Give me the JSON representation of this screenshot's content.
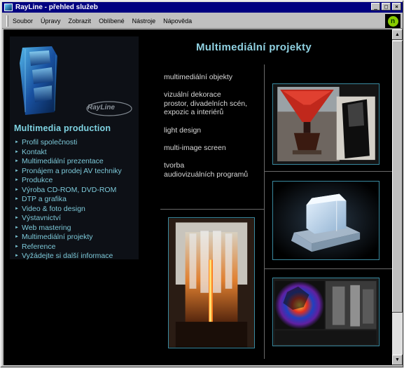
{
  "window": {
    "title": "RayLine - přehled služeb"
  },
  "menu": [
    {
      "label": "Soubor"
    },
    {
      "label": "Úpravy"
    },
    {
      "label": "Zobrazit"
    },
    {
      "label": "Oblíbené"
    },
    {
      "label": "Nástroje"
    },
    {
      "label": "Nápověda"
    }
  ],
  "sidebar": {
    "brand_badge": "RayLine",
    "heading": "Multimedia production",
    "items": [
      {
        "label": "Profil společnosti"
      },
      {
        "label": "Kontakt"
      },
      {
        "label": "Multimediální prezentace"
      },
      {
        "label": "Pronájem a prodej AV techniky"
      },
      {
        "label": "Produkce"
      },
      {
        "label": "Výroba CD-ROM, DVD-ROM"
      },
      {
        "label": "DTP a grafika"
      },
      {
        "label": "Video & foto design"
      },
      {
        "label": "Výstavnictví"
      },
      {
        "label": "Web mastering"
      },
      {
        "label": "Multimediální projekty"
      },
      {
        "label": "Reference"
      },
      {
        "label": "Vyžádejte si další informace"
      }
    ]
  },
  "main": {
    "title": "Multimediální projekty",
    "items": [
      {
        "label": "multimediální objekty"
      },
      {
        "line1": "vizuální dekorace",
        "line2": "prostor, divadelních scén,",
        "line3": "expozic a interiérů"
      },
      {
        "label": "light design"
      },
      {
        "label": "multi-image screen"
      },
      {
        "line1": "tvorba",
        "line2": "audiovizuálních programů"
      }
    ]
  },
  "colors": {
    "accent": "#8fd0e0",
    "nav_text": "#7cc8d8",
    "background": "#000000",
    "titlebar": "#000080"
  }
}
